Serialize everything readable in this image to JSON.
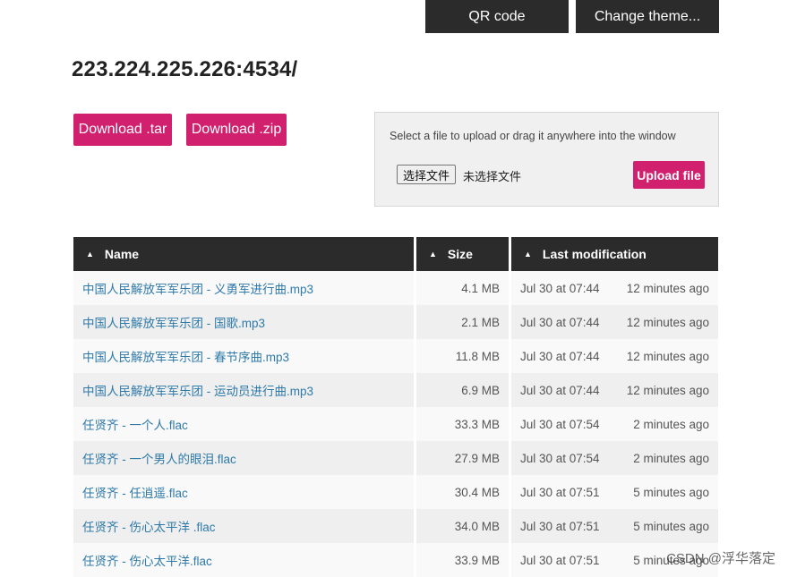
{
  "header": {
    "qr_label": "QR code",
    "theme_label": "Change theme..."
  },
  "page_title": "223.224.225.226:4534/",
  "downloads": {
    "tar_label": "Download .tar",
    "zip_label": "Download .zip"
  },
  "upload": {
    "hint": "Select a file to upload or drag it anywhere into the window",
    "choose_label": "选择文件",
    "status": "未选择文件",
    "button_label": "Upload file"
  },
  "table": {
    "columns": {
      "name": "Name",
      "size": "Size",
      "modified": "Last modification"
    },
    "rows": [
      {
        "name": "中国人民解放军军乐团 - 义勇军进行曲.mp3",
        "size": "4.1 MB",
        "date": "Jul 30 at 07:44",
        "ago": "12 minutes ago"
      },
      {
        "name": "中国人民解放军军乐团 - 国歌.mp3",
        "size": "2.1 MB",
        "date": "Jul 30 at 07:44",
        "ago": "12 minutes ago"
      },
      {
        "name": "中国人民解放军军乐团 - 春节序曲.mp3",
        "size": "11.8 MB",
        "date": "Jul 30 at 07:44",
        "ago": "12 minutes ago"
      },
      {
        "name": "中国人民解放军军乐团 - 运动员进行曲.mp3",
        "size": "6.9 MB",
        "date": "Jul 30 at 07:44",
        "ago": "12 minutes ago"
      },
      {
        "name": "任贤齐 - 一个人.flac",
        "size": "33.3 MB",
        "date": "Jul 30 at 07:54",
        "ago": "2 minutes ago"
      },
      {
        "name": "任贤齐 - 一个男人的眼泪.flac",
        "size": "27.9 MB",
        "date": "Jul 30 at 07:54",
        "ago": "2 minutes ago"
      },
      {
        "name": "任贤齐 - 任逍遥.flac",
        "size": "30.4 MB",
        "date": "Jul 30 at 07:51",
        "ago": "5 minutes ago"
      },
      {
        "name": "任贤齐 - 伤心太平洋 .flac",
        "size": "34.0 MB",
        "date": "Jul 30 at 07:51",
        "ago": "5 minutes ago"
      },
      {
        "name": "任贤齐 - 伤心太平洋.flac",
        "size": "33.9 MB",
        "date": "Jul 30 at 07:51",
        "ago": "5 minutes ago"
      }
    ]
  },
  "watermark": "CSDN @浮华落定",
  "colors": {
    "accent": "#d0206e",
    "header_bg": "#2b2b2b",
    "link": "#2f7aa8"
  }
}
